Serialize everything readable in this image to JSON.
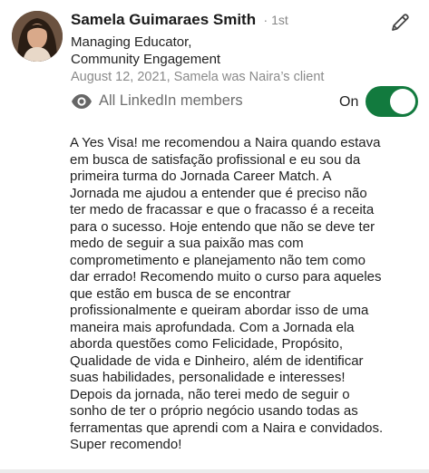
{
  "recommendation": {
    "author_name": "Samela Guimaraes Smith",
    "degree": "· 1st",
    "headline_line1": "Managing Educator,",
    "headline_line2": "Community Engagement",
    "date_relationship": "August 12, 2021, Samela was Naira’s client",
    "visibility_label": "All LinkedIn members",
    "toggle_label": "On",
    "toggle_on": true,
    "body_lines": [
      "A Yes Visa! me recomendou a Naira quando estava",
      "em busca de satisfação profissional e eu sou da",
      "primeira turma do Jornada Career Match. A",
      "Jornada me ajudou a entender que é preciso não",
      "ter medo de fracassar e que o fracasso é a receita",
      "para o sucesso. Hoje entendo que não se deve ter",
      "medo de seguir a sua paixão mas com",
      "comprometimento e planejamento não tem como",
      "dar errado! Recomendo muito o curso para aqueles",
      "que estão em busca de se encontrar",
      "profissionalmente e queiram abordar isso de uma",
      "maneira mais aprofundada. Com a Jornada ela",
      "aborda questões como Felicidade, Propósito,",
      "Qualidade de vida e Dinheiro, além de identificar",
      "suas habilidades, personalidade e interesses!",
      "Depois da jornada, não terei medo de seguir o",
      "sonho de ter o próprio negócio usando todas as",
      "ferramentas que aprendi com a Naira e convidados.",
      "Super recomendo!"
    ],
    "colors": {
      "toggle_on": "#127a3e",
      "muted_text": "#8a8a8a"
    },
    "icons": {
      "edit": "pencil-icon",
      "visibility": "eye-icon"
    }
  }
}
